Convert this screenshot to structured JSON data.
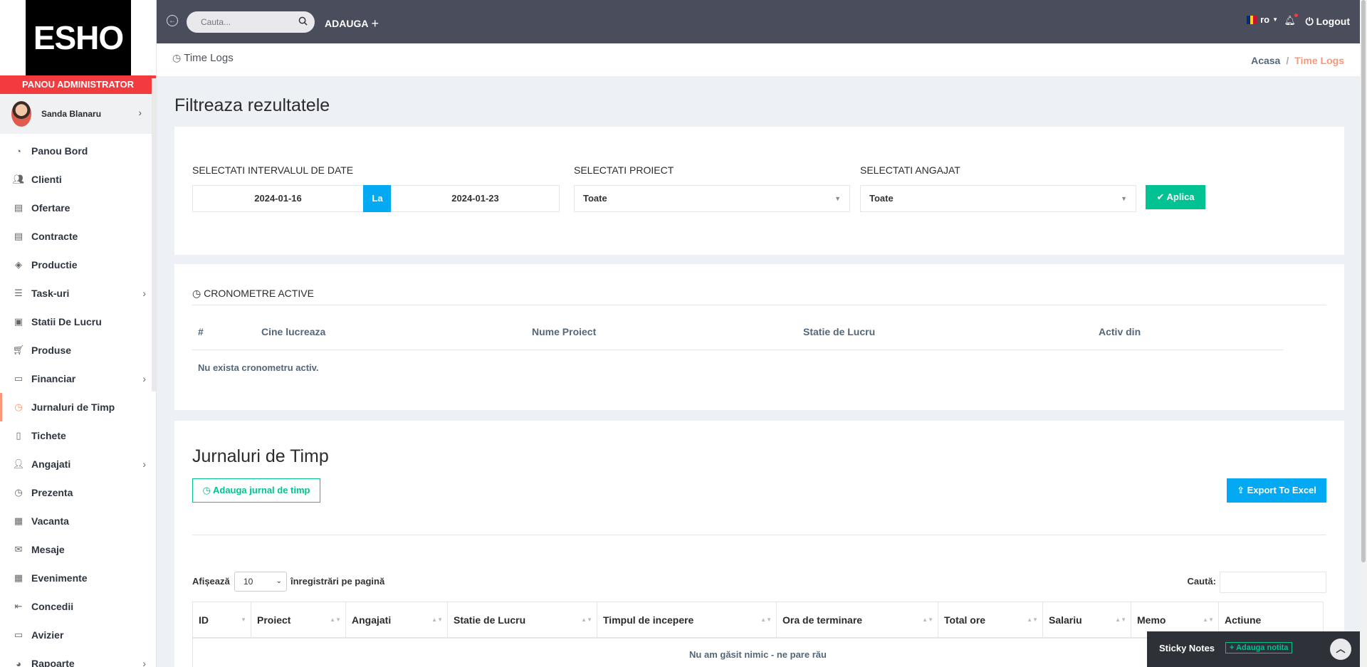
{
  "sidebar": {
    "logo": "ESHO",
    "admin_panel": "PANOU ADMINISTRATOR",
    "user_name": "Sanda Blanaru",
    "items": [
      {
        "label": "Panou Bord",
        "icon": "dashboard-icon",
        "chev": false
      },
      {
        "label": "Clienti",
        "icon": "users-icon",
        "chev": false
      },
      {
        "label": "Ofertare",
        "icon": "document-icon",
        "chev": false
      },
      {
        "label": "Contracte",
        "icon": "contract-icon",
        "chev": false
      },
      {
        "label": "Productie",
        "icon": "layers-icon",
        "chev": false
      },
      {
        "label": "Task-uri",
        "icon": "tasks-icon",
        "chev": true
      },
      {
        "label": "Statii De Lucru",
        "icon": "workstation-icon",
        "chev": false
      },
      {
        "label": "Produse",
        "icon": "cart-icon",
        "chev": false
      },
      {
        "label": "Financiar",
        "icon": "money-icon",
        "chev": true
      },
      {
        "label": "Jurnaluri de Timp",
        "icon": "clock-icon",
        "chev": false,
        "active": true
      },
      {
        "label": "Tichete",
        "icon": "ticket-icon",
        "chev": false
      },
      {
        "label": "Angajati",
        "icon": "user-icon",
        "chev": true
      },
      {
        "label": "Prezenta",
        "icon": "clock-icon",
        "chev": false
      },
      {
        "label": "Vacanta",
        "icon": "calendar-icon",
        "chev": false
      },
      {
        "label": "Mesaje",
        "icon": "envelope-icon",
        "chev": false
      },
      {
        "label": "Evenimente",
        "icon": "calendar-grid-icon",
        "chev": false
      },
      {
        "label": "Concedii",
        "icon": "sign-out-icon",
        "chev": false
      },
      {
        "label": "Avizier",
        "icon": "monitor-icon",
        "chev": false
      },
      {
        "label": "Rapoarte",
        "icon": "pie-chart-icon",
        "chev": true
      }
    ]
  },
  "topbar": {
    "search_placeholder": "Cauta...",
    "add_label": "ADAUGA",
    "lang": "ro",
    "logout": "Logout",
    "flag_colors": [
      "#002b7f",
      "#fcd116",
      "#ce1126"
    ]
  },
  "breadcrumb": {
    "title": "Time Logs",
    "home": "Acasa",
    "separator": "/",
    "current": "Time Logs"
  },
  "filter": {
    "heading": "Filtreaza rezultatele",
    "date_label": "SELECTATI INTERVALUL DE DATE",
    "date_from": "2024-01-16",
    "date_to_label": "La",
    "date_to": "2024-01-23",
    "project_label": "SELECTATI PROIECT",
    "project_value": "Toate",
    "employee_label": "SELECTATI ANGAJAT",
    "employee_value": "Toate",
    "apply": "Aplica"
  },
  "timers": {
    "title": "CRONOMETRE ACTIVE",
    "columns": [
      "#",
      "Cine lucreaza",
      "Nume Proiect",
      "Statie de Lucru",
      "Activ din"
    ],
    "empty": "Nu exista cronometru activ."
  },
  "logs": {
    "heading": "Jurnaluri de Timp",
    "add_button": "Adauga jurnal de timp",
    "export_button": "Export To Excel",
    "show_label": "Afișează",
    "page_size": "10",
    "show_after": "înregistrări pe pagină",
    "search_label": "Caută:",
    "columns": [
      "ID",
      "Proiect",
      "Angajati",
      "Statie de Lucru",
      "Timpul de incepere",
      "Ora de terminare",
      "Total ore",
      "Salariu",
      "Memo",
      "Actiune"
    ],
    "empty": "Nu am găsit nimic - ne pare rău"
  },
  "sticky": {
    "title": "Sticky Notes",
    "add": "Adauga notita"
  },
  "colors": {
    "accent_red": "#f33a3f",
    "topbar": "#4a4d5b",
    "active_nav": "#fb9678",
    "success": "#00c292",
    "info": "#03a9f3"
  }
}
